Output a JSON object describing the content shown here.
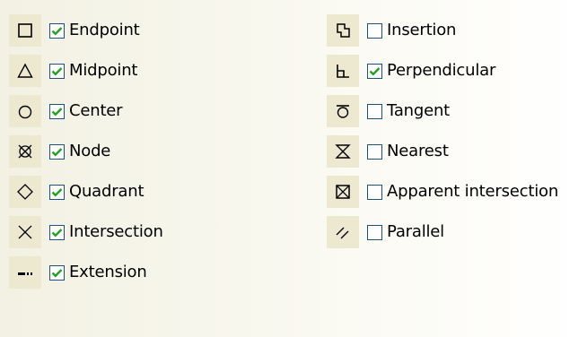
{
  "left_column": [
    {
      "icon": "endpoint-icon",
      "label": "Endpoint",
      "checked": true
    },
    {
      "icon": "midpoint-icon",
      "label": "Midpoint",
      "checked": true
    },
    {
      "icon": "center-icon",
      "label": "Center",
      "checked": true
    },
    {
      "icon": "node-icon",
      "label": "Node",
      "checked": true
    },
    {
      "icon": "quadrant-icon",
      "label": "Quadrant",
      "checked": true
    },
    {
      "icon": "intersection-icon",
      "label": "Intersection",
      "checked": true
    },
    {
      "icon": "extension-icon",
      "label": "Extension",
      "checked": true
    }
  ],
  "right_column": [
    {
      "icon": "insertion-icon",
      "label": "Insertion",
      "checked": false
    },
    {
      "icon": "perpendicular-icon",
      "label": "Perpendicular",
      "checked": true
    },
    {
      "icon": "tangent-icon",
      "label": "Tangent",
      "checked": false
    },
    {
      "icon": "nearest-icon",
      "label": "Nearest",
      "checked": false
    },
    {
      "icon": "apparent-intersection-icon",
      "label": "Apparent intersection",
      "checked": false
    },
    {
      "icon": "parallel-icon",
      "label": "Parallel",
      "checked": false
    }
  ],
  "colors": {
    "checkmark": "#21a121",
    "checkbox_border": "#1c5180",
    "icon_bg": "#ece9d0"
  }
}
